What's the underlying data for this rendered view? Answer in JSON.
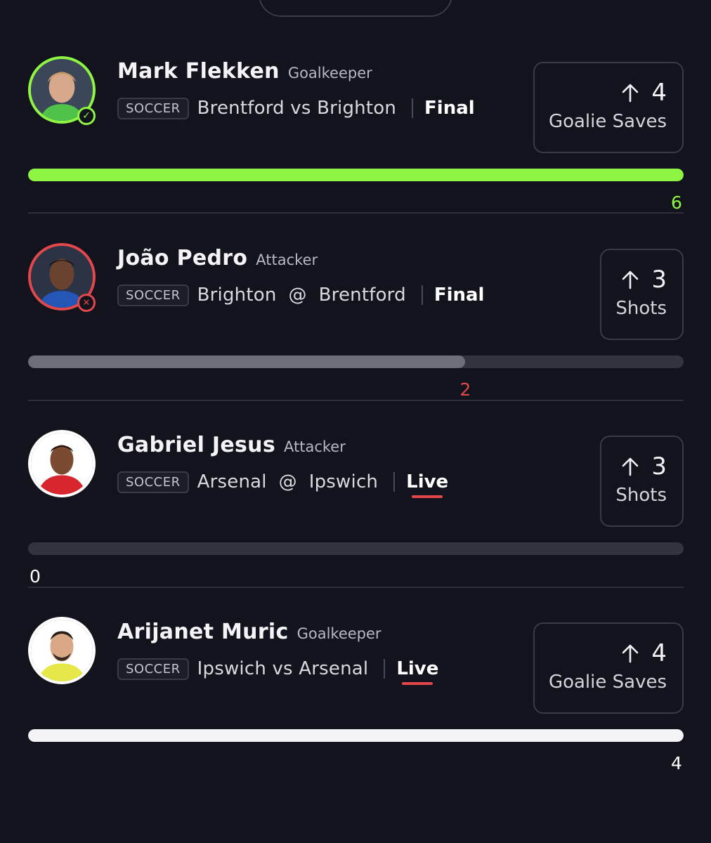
{
  "cards": [
    {
      "player": "Mark Flekken",
      "position": "Goalkeeper",
      "sport": "SOCCER",
      "matchup": "Brentford vs Brighton",
      "status": "Final",
      "line": "4",
      "stat": "Goalie Saves",
      "current": "6",
      "progress": 1.0,
      "result": "win",
      "fill_color": "#8ef542",
      "value_color": "#8ef542",
      "avatar_icon": "player-photo",
      "status_icon": "check-circle-icon"
    },
    {
      "player": "João Pedro",
      "position": "Attacker",
      "sport": "SOCCER",
      "matchup": "Brighton  @  Brentford",
      "status": "Final",
      "line": "3",
      "stat": "Shots",
      "current": "2",
      "progress": 0.667,
      "result": "lose",
      "fill_color": "#6e6e78",
      "value_color": "#e2474b",
      "avatar_icon": "player-photo",
      "status_icon": "x-circle-icon"
    },
    {
      "player": "Gabriel Jesus",
      "position": "Attacker",
      "sport": "SOCCER",
      "matchup": "Arsenal  @  Ipswich",
      "status": "Live",
      "line": "3",
      "stat": "Shots",
      "current": "0",
      "progress": 0.0,
      "result": "live",
      "fill_color": "#ffffff",
      "value_color": "#ffffff",
      "avatar_icon": "player-photo",
      "status_icon": ""
    },
    {
      "player": "Arijanet Muric",
      "position": "Goalkeeper",
      "sport": "SOCCER",
      "matchup": "Ipswich vs Arsenal",
      "status": "Live",
      "line": "4",
      "stat": "Goalie Saves",
      "current": "4",
      "progress": 1.0,
      "result": "live",
      "fill_color": "#f4f4f8",
      "value_color": "#ffffff",
      "avatar_icon": "player-photo",
      "status_icon": ""
    }
  ],
  "icons": {
    "line_direction": "arrow-up-icon"
  }
}
